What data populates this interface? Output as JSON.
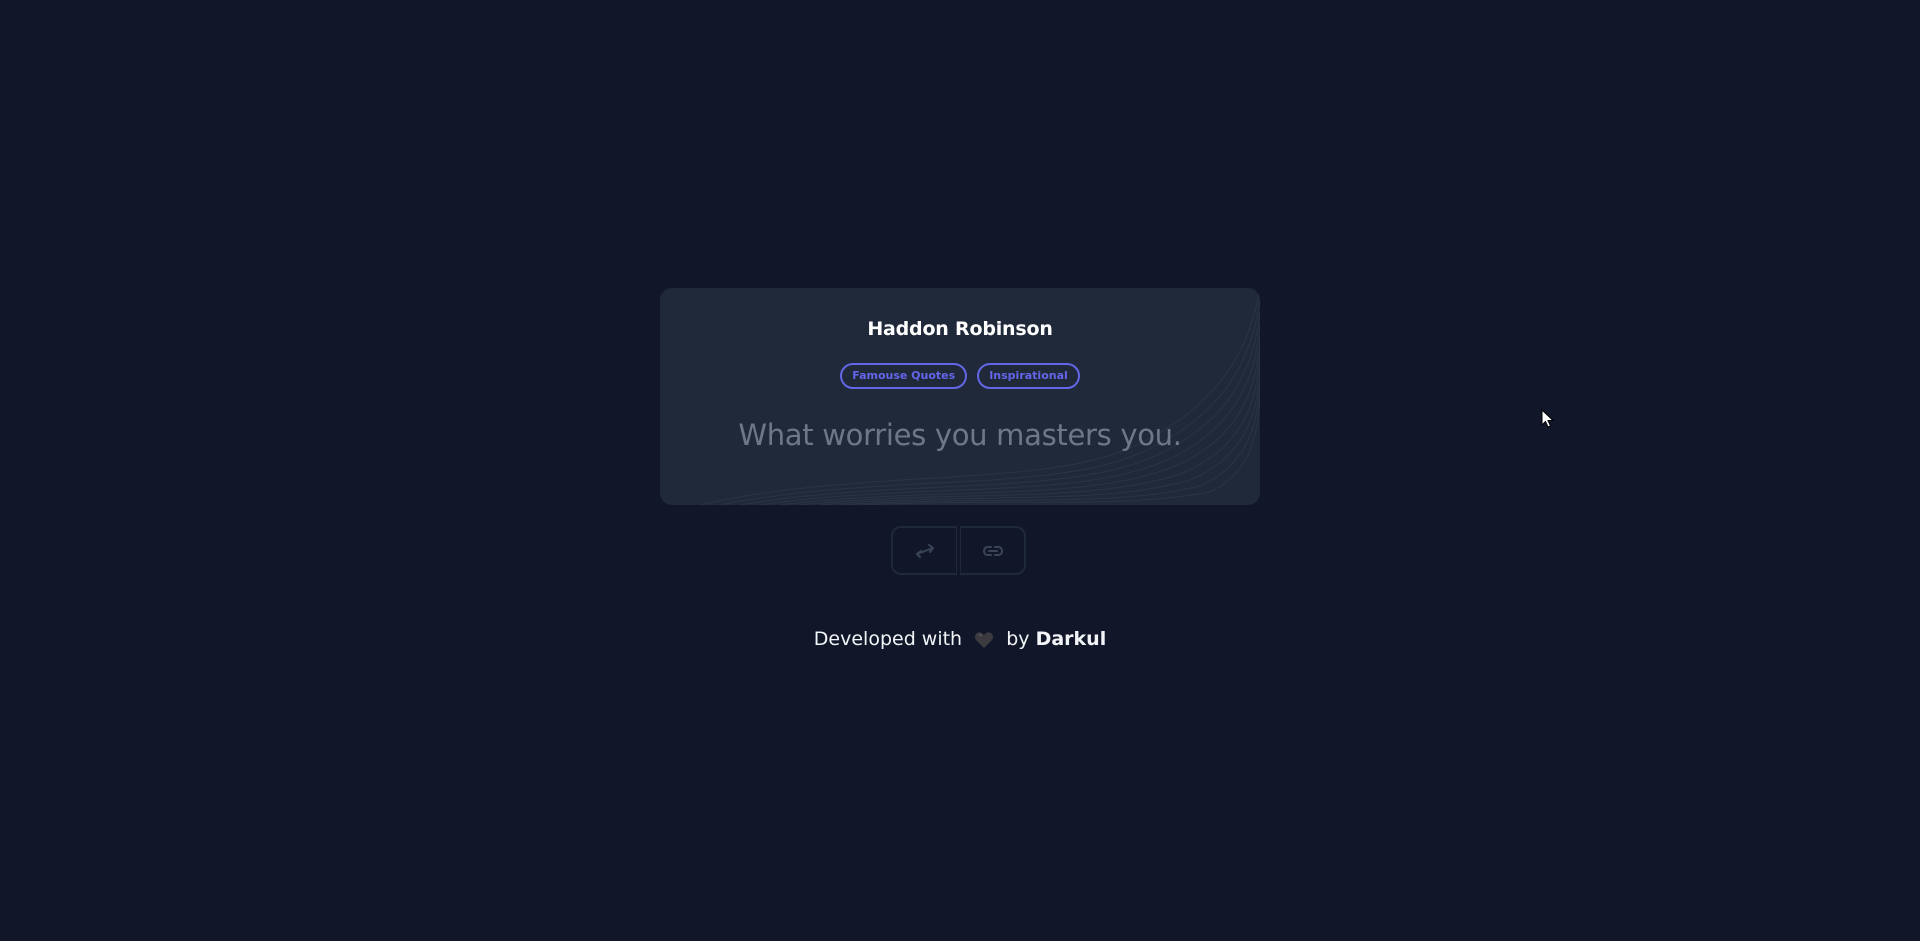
{
  "card": {
    "author": "Haddon Robinson",
    "tags": [
      "Famouse Quotes",
      "Inspirational"
    ],
    "quote": "What worries you masters you."
  },
  "actions": [
    {
      "icon": "shuffle-arrows-icon"
    },
    {
      "icon": "link-icon"
    }
  ],
  "footer": {
    "prefix": "Developed with",
    "heart_icon": "heart-icon",
    "by": "by",
    "brand": "Darkul"
  },
  "colors": {
    "background": "#111729",
    "card": "#20293a",
    "accent": "#6466e9",
    "quote_text": "#6c7889",
    "heading_text": "#ffffff"
  }
}
